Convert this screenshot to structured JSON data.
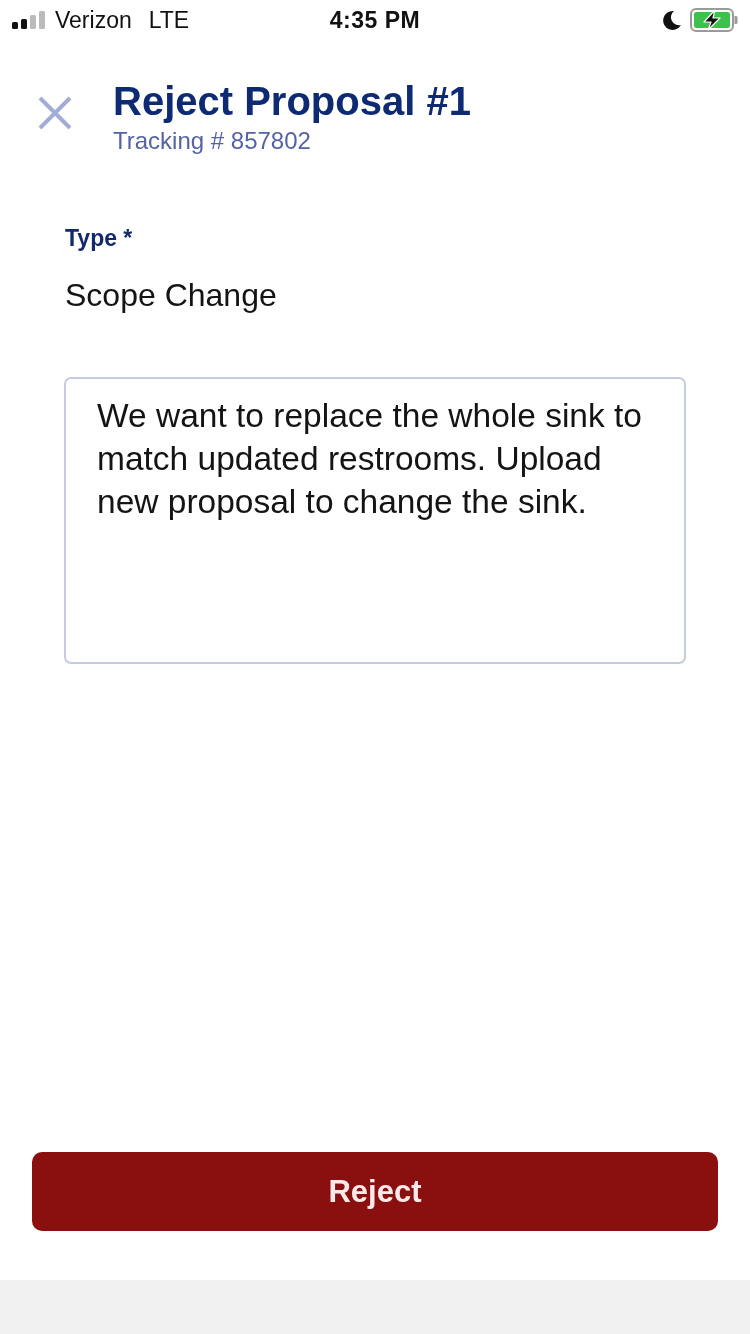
{
  "status_bar": {
    "carrier": "Verizon",
    "network": "LTE",
    "time": "4:35 PM"
  },
  "header": {
    "title": "Reject Proposal #1",
    "subtitle": "Tracking # 857802"
  },
  "form": {
    "type_field": {
      "label": "Type *",
      "value": "Scope Change"
    },
    "comment_field": {
      "value": "We want to replace the whole sink to match updated restrooms. Upload new proposal to change the sink."
    }
  },
  "primary_button": {
    "label": "Reject"
  }
}
